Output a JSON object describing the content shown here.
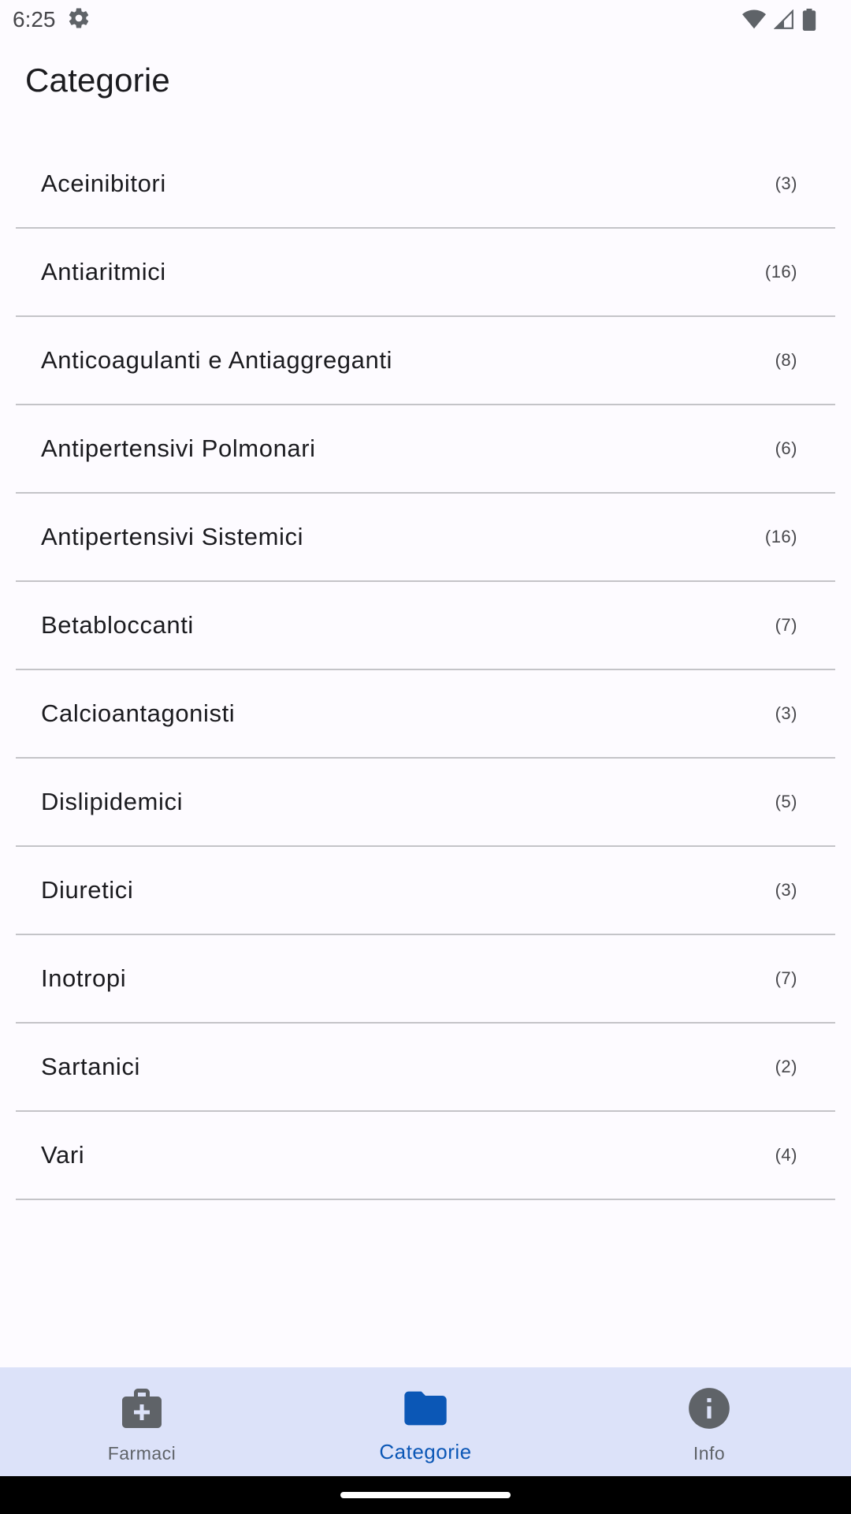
{
  "status_bar": {
    "time": "6:25",
    "icons": [
      "settings-gear-icon",
      "wifi-icon",
      "cell-signal-icon",
      "battery-icon"
    ]
  },
  "app_bar": {
    "title": "Categorie"
  },
  "categories": [
    {
      "label": "Aceinibitori",
      "count": "(3)"
    },
    {
      "label": "Antiaritmici",
      "count": "(16)"
    },
    {
      "label": "Anticoagulanti e Antiaggreganti",
      "count": "(8)"
    },
    {
      "label": "Antipertensivi Polmonari",
      "count": "(6)"
    },
    {
      "label": "Antipertensivi Sistemici",
      "count": "(16)"
    },
    {
      "label": "Betabloccanti",
      "count": "(7)"
    },
    {
      "label": "Calcioantagonisti",
      "count": "(3)"
    },
    {
      "label": "Dislipidemici",
      "count": "(5)"
    },
    {
      "label": "Diuretici",
      "count": "(3)"
    },
    {
      "label": "Inotropi",
      "count": "(7)"
    },
    {
      "label": "Sartanici",
      "count": "(2)"
    },
    {
      "label": "Vari",
      "count": "(4)"
    }
  ],
  "bottom_nav": {
    "items": [
      {
        "label": "Farmaci",
        "icon": "medical-bag-icon",
        "active": false
      },
      {
        "label": "Categorie",
        "icon": "folder-icon",
        "active": true
      },
      {
        "label": "Info",
        "icon": "info-icon",
        "active": false
      }
    ]
  },
  "colors": {
    "background": "#fdfbff",
    "nav_background": "#dce2f9",
    "active": "#0b57b6",
    "inactive_icon": "#5f6368",
    "divider": "#c4c4c8"
  }
}
